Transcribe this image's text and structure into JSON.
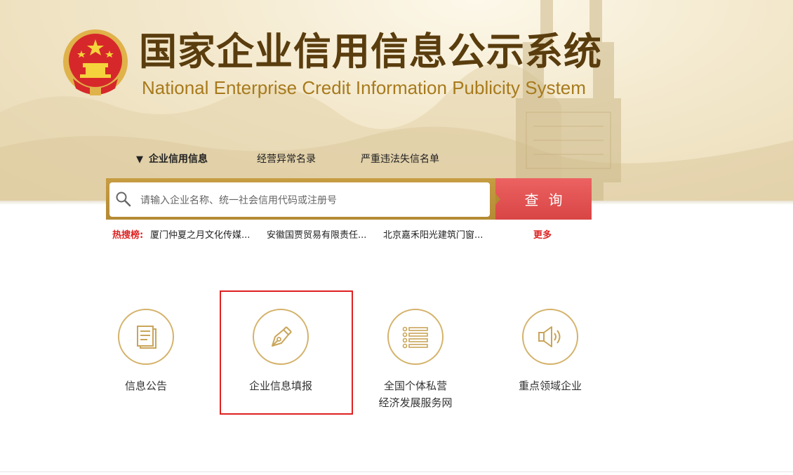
{
  "header": {
    "title_cn": "国家企业信用信息公示系统",
    "title_en": "National Enterprise Credit Information Publicity System"
  },
  "tabs": [
    {
      "label": "企业信用信息",
      "active": true
    },
    {
      "label": "经营异常名录",
      "active": false
    },
    {
      "label": "严重违法失信名单",
      "active": false
    }
  ],
  "search": {
    "placeholder": "请输入企业名称、统一社会信用代码或注册号",
    "value": "",
    "button_label": "查询"
  },
  "hot": {
    "label": "热搜榜:",
    "items": [
      "厦门仲夏之月文化传媒...",
      "安徽国贾贸易有限责任...",
      "北京嘉禾阳光建筑门窗..."
    ],
    "more": "更多"
  },
  "features": [
    {
      "label": "信息公告",
      "icon": "document-icon"
    },
    {
      "label": "企业信息填报",
      "icon": "pen-nib-icon",
      "selected": true
    },
    {
      "label_line1": "全国个体私营",
      "label_line2": "经济发展服务网",
      "icon": "list-icon"
    },
    {
      "label": "重点领域企业",
      "icon": "speaker-icon"
    }
  ],
  "colors": {
    "title": "#5a3d0e",
    "subtitle": "#a77a1c",
    "gold_border": "#b48a33",
    "search_button": "#e04f4f",
    "hot_label": "#dd2222",
    "selection_frame": "#e02020",
    "icon_circle": "#d4b26a"
  }
}
